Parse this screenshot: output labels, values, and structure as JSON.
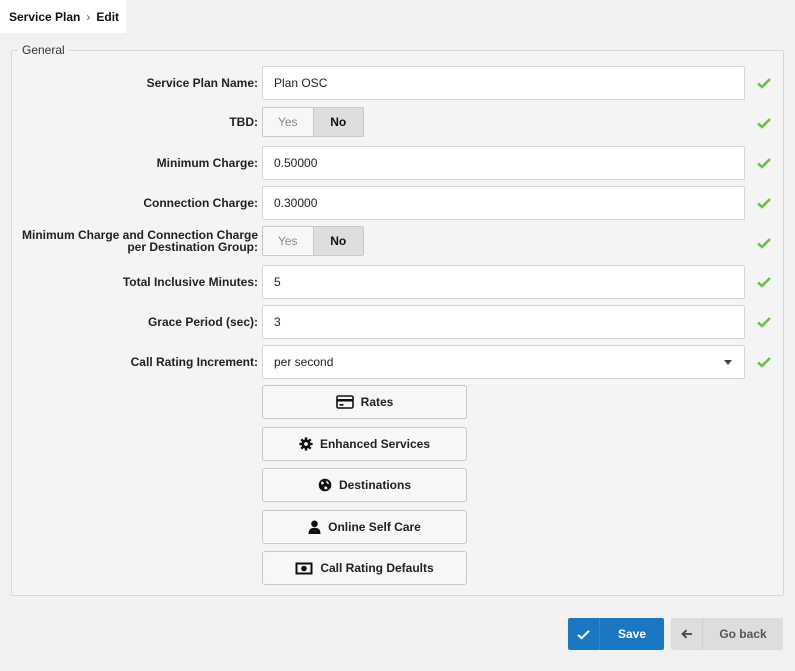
{
  "breadcrumb": {
    "parent": "Service Plan",
    "separator": "›",
    "current": "Edit"
  },
  "panel": {
    "legend": "General"
  },
  "fields": {
    "service_plan_name": {
      "label": "Service Plan Name:",
      "value": "Plan OSC"
    },
    "tbd": {
      "label": "TBD:",
      "yes": "Yes",
      "no": "No",
      "selected": "No"
    },
    "minimum_charge": {
      "label": "Minimum Charge:",
      "value": "0.50000"
    },
    "connection_charge": {
      "label": "Connection Charge:",
      "value": "0.30000"
    },
    "per_destination_group": {
      "label_line1": "Minimum Charge and Connection Charge",
      "label_line2": "per Destination Group:",
      "yes": "Yes",
      "no": "No",
      "selected": "No"
    },
    "total_inclusive_minutes": {
      "label": "Total Inclusive Minutes:",
      "value": "5"
    },
    "grace_period": {
      "label": "Grace Period (sec):",
      "value": "3"
    },
    "call_rating_increment": {
      "label": "Call Rating Increment:",
      "value": "per second"
    }
  },
  "buttons": {
    "rates": "Rates",
    "enhanced_services": "Enhanced Services",
    "destinations": "Destinations",
    "online_self_care": "Online Self Care",
    "call_rating_defaults": "Call Rating Defaults"
  },
  "footer": {
    "save": "Save",
    "go_back": "Go back"
  },
  "colors": {
    "accent": "#1a78c2",
    "check": "#6cc04a"
  }
}
